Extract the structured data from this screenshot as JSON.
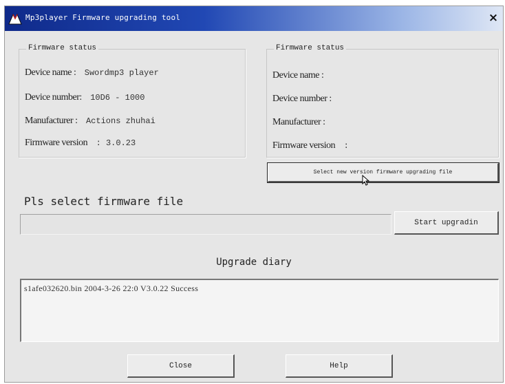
{
  "window": {
    "title": "Mp3player Firmware upgrading tool",
    "close_glyph": "×"
  },
  "current_firmware": {
    "legend": "Firmware status",
    "fields": [
      {
        "label": "Device name :",
        "value": "Swordmp3 player"
      },
      {
        "label": "Device number:",
        "value": "10D6 - 1000"
      },
      {
        "label": "Manufacturer :",
        "value": "Actions zhuhai"
      },
      {
        "label": "Firmware version",
        "value": ": 3.0.23"
      }
    ]
  },
  "new_firmware": {
    "legend": "Firmware status",
    "fields": [
      {
        "label": "Device name :",
        "value": ""
      },
      {
        "label": "Device number :",
        "value": ""
      },
      {
        "label": "Manufacturer :",
        "value": ""
      },
      {
        "label": "Firmware version",
        "value": ":"
      }
    ]
  },
  "select_new_button": "Select new version firmware upgrading file",
  "select_file_label": "Pls select firmware file",
  "firmware_file_input": {
    "value": "",
    "placeholder": ""
  },
  "start_button": "Start upgradin",
  "diary": {
    "title": "Upgrade diary",
    "entries": [
      "s1afe032620.bin   2004-3-26   22:0   V3.0.22   Success"
    ]
  },
  "close_button": "Close",
  "help_button": "Help",
  "icons": {
    "app": "mp3-tool-icon",
    "cursor": "mouse-pointer-icon"
  }
}
